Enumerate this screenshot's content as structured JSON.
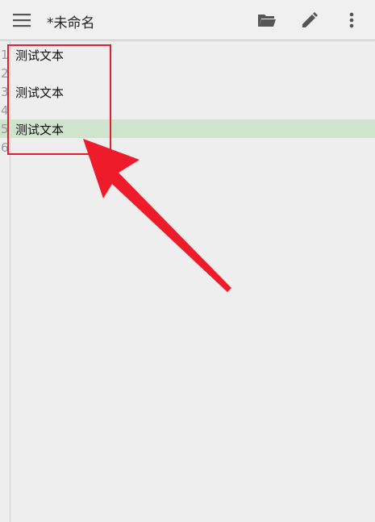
{
  "toolbar": {
    "title": "*未命名",
    "menu_icon": "hamburger-menu-icon",
    "open_icon": "folder-open-icon",
    "edit_icon": "pencil-icon",
    "more_icon": "more-vertical-icon"
  },
  "editor": {
    "current_line": 5,
    "lines": [
      {
        "number": "1",
        "text": "测试文本"
      },
      {
        "number": "2",
        "text": ""
      },
      {
        "number": "3",
        "text": "测试文本"
      },
      {
        "number": "4",
        "text": ""
      },
      {
        "number": "5",
        "text": "测试文本"
      },
      {
        "number": "6",
        "text": ""
      }
    ]
  },
  "annotation": {
    "box_color": "#e02030",
    "arrow_color": "#ee1c2a"
  },
  "colors": {
    "background": "#efeeee",
    "current_line_highlight": "#cfe3cf",
    "line_number": "#9a9a9a"
  }
}
